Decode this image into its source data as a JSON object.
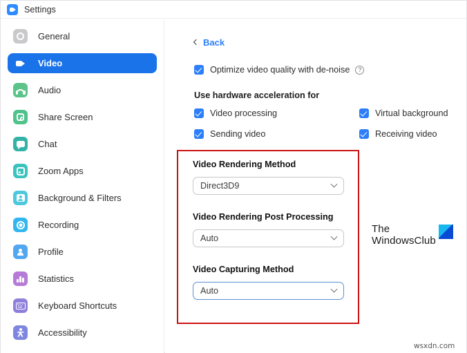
{
  "window": {
    "title": "Settings",
    "app_icon": "zoom-video-icon"
  },
  "sidebar": {
    "items": [
      {
        "label": "General",
        "icon": "gear-icon",
        "color": "#c9c9cc",
        "active": false
      },
      {
        "label": "Video",
        "icon": "video-camera-icon",
        "color": "#1a73e8",
        "active": true
      },
      {
        "label": "Audio",
        "icon": "headset-icon",
        "color": "#5cc48a",
        "active": false
      },
      {
        "label": "Share Screen",
        "icon": "share-screen-icon",
        "color": "#4fc38b",
        "active": false
      },
      {
        "label": "Chat",
        "icon": "chat-bubble-icon",
        "color": "#33b3a6",
        "active": false
      },
      {
        "label": "Zoom Apps",
        "icon": "zoom-apps-icon",
        "color": "#3cc3bd",
        "active": false
      },
      {
        "label": "Background & Filters",
        "icon": "background-filters-icon",
        "color": "#4ec8dd",
        "active": false
      },
      {
        "label": "Recording",
        "icon": "record-icon",
        "color": "#33b6ef",
        "active": false
      },
      {
        "label": "Profile",
        "icon": "profile-icon",
        "color": "#51a7f0",
        "active": false
      },
      {
        "label": "Statistics",
        "icon": "statistics-icon",
        "color": "#b57bd6",
        "active": false
      },
      {
        "label": "Keyboard Shortcuts",
        "icon": "keyboard-icon",
        "color": "#8f7fdc",
        "active": false
      },
      {
        "label": "Accessibility",
        "icon": "accessibility-icon",
        "color": "#7e86e0",
        "active": false
      }
    ]
  },
  "main": {
    "back_label": "Back",
    "denoise": {
      "label": "Optimize video quality with de-noise",
      "checked": true,
      "help": "?"
    },
    "hardware_acceleration": {
      "heading": "Use hardware acceleration for",
      "options": [
        {
          "label": "Video processing",
          "checked": true
        },
        {
          "label": "Virtual background",
          "checked": true
        },
        {
          "label": "Sending video",
          "checked": true
        },
        {
          "label": "Receiving video",
          "checked": true
        }
      ]
    },
    "advanced_fields": [
      {
        "label": "Video Rendering Method",
        "value": "Direct3D9",
        "focused": false
      },
      {
        "label": "Video Rendering Post Processing",
        "value": "Auto",
        "focused": false
      },
      {
        "label": "Video Capturing Method",
        "value": "Auto",
        "focused": true
      }
    ]
  },
  "annotations": {
    "highlight_color": "#cc1111"
  },
  "watermarks": {
    "brand_line1": "The",
    "brand_line2": "WindowsClub",
    "site": "wsxdn.com"
  }
}
